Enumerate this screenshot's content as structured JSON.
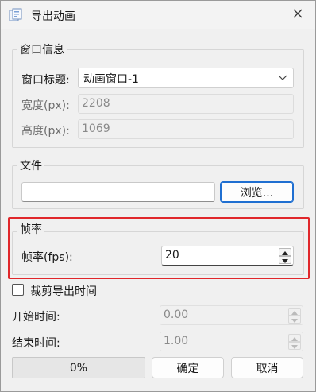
{
  "window": {
    "title": "导出动画"
  },
  "window_group": {
    "legend": "窗口信息",
    "title_label": "窗口标题:",
    "title_value": "动画窗口-1",
    "width_label": "宽度(px):",
    "width_value": "2208",
    "height_label": "高度(px):",
    "height_value": "1069"
  },
  "file_group": {
    "legend": "文件",
    "path_value": "",
    "browse_label": "浏览..."
  },
  "fps_group": {
    "legend": "帧率",
    "fps_label": "帧率(fps):",
    "fps_value": "20"
  },
  "crop": {
    "checkbox_label": "裁剪导出时间",
    "checked": false,
    "start_label": "开始时间:",
    "start_value": "0.00",
    "end_label": "结束时间:",
    "end_value": "1.00"
  },
  "footer": {
    "progress_text": "0%",
    "progress_fraction": 0,
    "ok_label": "确定",
    "cancel_label": "取消"
  },
  "colors": {
    "highlight": "#e0272b",
    "focus": "#1f6fd1",
    "background": "#f0f0f0"
  }
}
